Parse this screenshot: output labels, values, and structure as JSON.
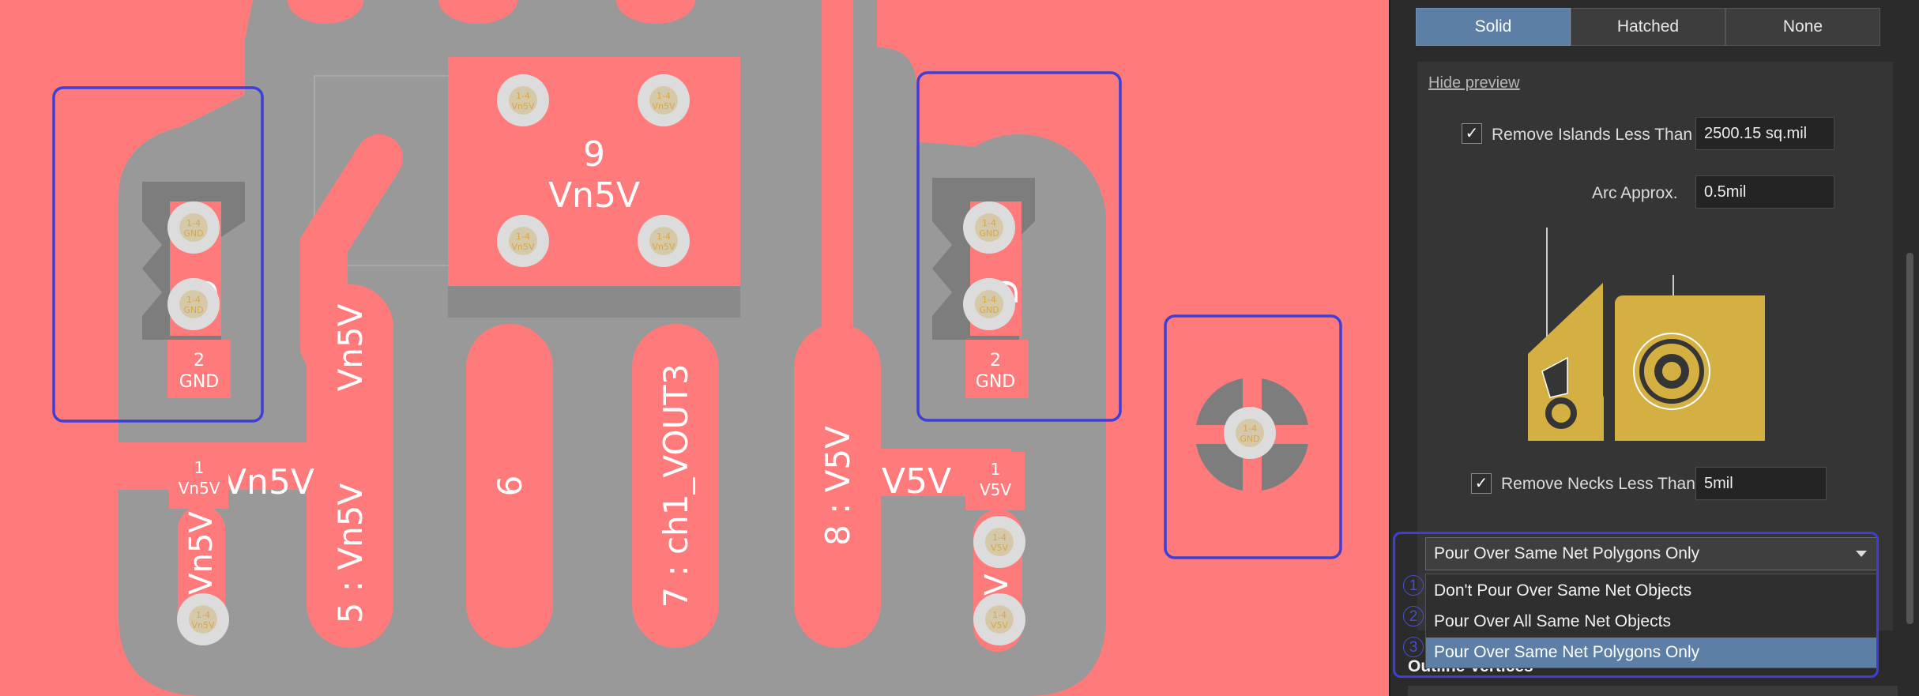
{
  "pcb": {
    "component_labels": {
      "c9_number": "9",
      "c9_net": "Vn5V",
      "net5": "5 : Vn5V",
      "net5_short": "Vn5V",
      "net6": "6",
      "net7": "7 : ch1_VOUT3",
      "net8": "8 : V5V",
      "left_net": "Vn5V",
      "left_trace": "Vn5V",
      "right_net": "V5V",
      "gnd_left_partial": "D",
      "gnd_right_partial": "D",
      "right_trace": "V"
    },
    "pads": {
      "left_pad2_num": "2",
      "left_pad2_net": "GND",
      "right_pad2_num": "2",
      "right_pad2_net": "GND",
      "left_pad1_num": "1",
      "left_pad1_net": "Vn5V",
      "right_pad1_num": "1",
      "right_pad1_net": "V5V"
    },
    "via_label": {
      "layers": "1-4",
      "net_vn5v": "Vn5V",
      "net_gnd": "GND",
      "net_v5v": "V5V"
    }
  },
  "panel": {
    "fill_mode": {
      "options": [
        "Solid",
        "Hatched",
        "None"
      ],
      "selected": "Solid"
    },
    "hide_preview": "Hide preview",
    "remove_islands": {
      "label": "Remove Islands Less Than",
      "checked": true,
      "value": "2500.15 sq.mil"
    },
    "arc_approx": {
      "label": "Arc Approx.",
      "value": "0.5mil"
    },
    "remove_necks": {
      "label": "Remove Necks Less Than",
      "checked": true,
      "value": "5mil"
    },
    "pour_over": {
      "selected": "Pour Over Same Net Polygons Only",
      "options": [
        "Don't Pour Over Same Net Objects",
        "Pour Over All Same Net Objects",
        "Pour Over Same Net Polygons Only"
      ],
      "numbers": [
        "1",
        "2",
        "3"
      ]
    },
    "section_behind": "Outline Vertices",
    "colors": {
      "accent": "#5d7fa6",
      "highlight": "#3d3fd6",
      "copper": "#d4b043"
    }
  }
}
